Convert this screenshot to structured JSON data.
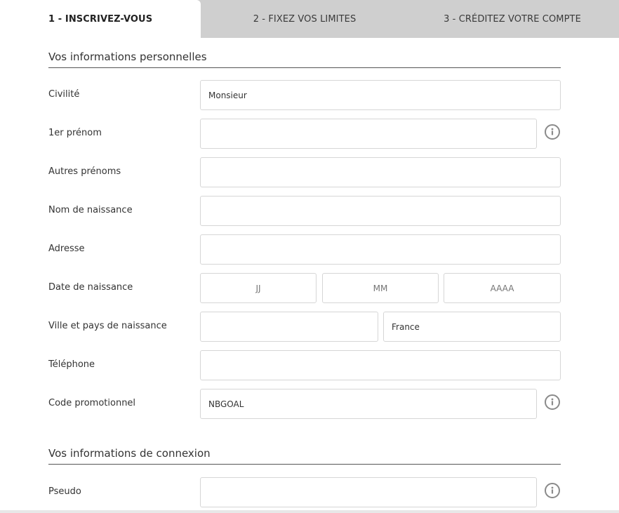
{
  "tabs": [
    {
      "label": "1 - INSCRIVEZ-VOUS",
      "active": true
    },
    {
      "label": "2 - FIXEZ VOS LIMITES",
      "active": false
    },
    {
      "label": "3 - CRÉDITEZ VOTRE COMPTE",
      "active": false
    }
  ],
  "personal": {
    "title": "Vos informations personnelles",
    "civilite": {
      "label": "Civilité",
      "value": "Monsieur"
    },
    "prenom": {
      "label": "1er prénom",
      "value": ""
    },
    "autres_prenoms": {
      "label": "Autres prénoms",
      "value": ""
    },
    "nom_naissance": {
      "label": "Nom de naissance",
      "value": ""
    },
    "adresse": {
      "label": "Adresse",
      "value": ""
    },
    "date_naissance": {
      "label": "Date de naissance",
      "day_placeholder": "JJ",
      "month_placeholder": "MM",
      "year_placeholder": "AAAA"
    },
    "lieu_naissance": {
      "label": "Ville et pays de naissance",
      "ville_value": "",
      "pays_value": "France"
    },
    "telephone": {
      "label": "Téléphone",
      "value": ""
    },
    "code_promo": {
      "label": "Code promotionnel",
      "value": "NBGOAL"
    }
  },
  "connexion": {
    "title": "Vos informations de connexion",
    "pseudo": {
      "label": "Pseudo",
      "value": ""
    }
  },
  "icons": {
    "info": "info-circle-icon"
  },
  "colors": {
    "tab_inactive_bg": "#cfcfcf",
    "icon_gray": "#8a8a8a",
    "border": "#d6d6d6"
  }
}
